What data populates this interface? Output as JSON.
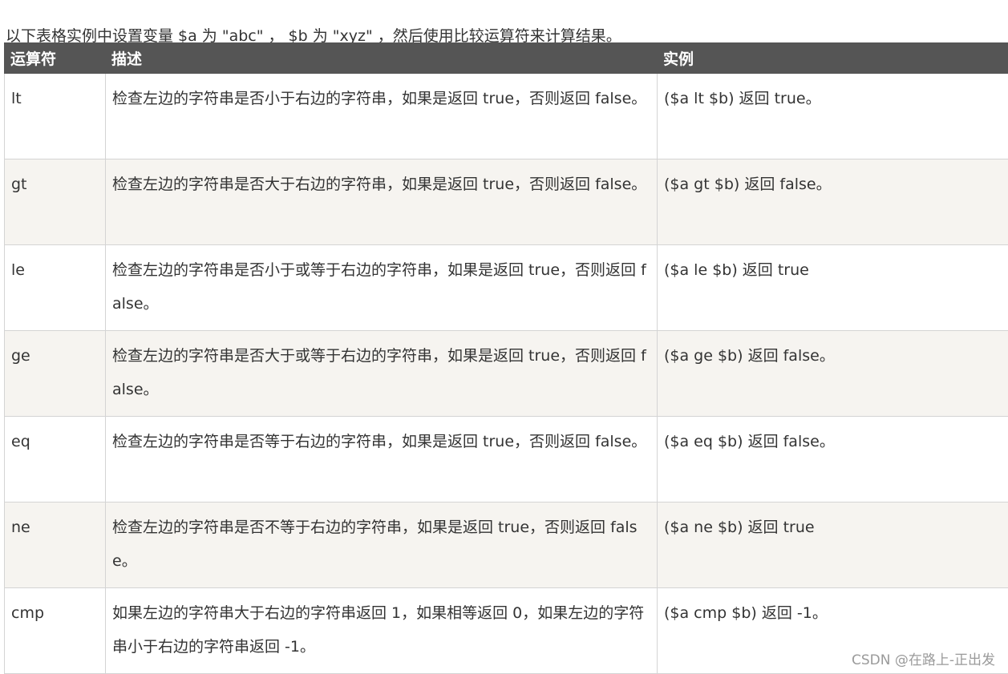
{
  "intro": "以下表格实例中设置变量 $a 为 \"abc\" ， $b 为 \"xyz\" ，然后使用比较运算符来计算结果。",
  "table": {
    "headers": [
      "运算符",
      "描述",
      "实例"
    ],
    "rows": [
      {
        "op": "lt",
        "desc": "检查左边的字符串是否小于右边的字符串，如果是返回 true，否则返回 false。",
        "example": "($a lt $b) 返回 true。"
      },
      {
        "op": "gt",
        "desc": "检查左边的字符串是否大于右边的字符串，如果是返回 true，否则返回 false。",
        "example": "($a gt $b) 返回 false。"
      },
      {
        "op": "le",
        "desc": "检查左边的字符串是否小于或等于右边的字符串，如果是返回 true，否则返回 false。",
        "example": "($a le $b) 返回 true"
      },
      {
        "op": "ge",
        "desc": "检查左边的字符串是否大于或等于右边的字符串，如果是返回 true，否则返回 false。",
        "example": "($a ge $b) 返回 false。"
      },
      {
        "op": "eq",
        "desc": "检查左边的字符串是否等于右边的字符串，如果是返回 true，否则返回 false。",
        "example": "($a eq $b) 返回 false。"
      },
      {
        "op": "ne",
        "desc": "检查左边的字符串是否不等于右边的字符串，如果是返回 true，否则返回 false。",
        "example": "($a ne $b) 返回 true"
      },
      {
        "op": "cmp",
        "desc": "如果左边的字符串大于右边的字符串返回 1，如果相等返回 0，如果左边的字符串小于右边的字符串返回 -1。",
        "example": "($a cmp $b) 返回 -1。"
      }
    ]
  },
  "watermark": "CSDN @在路上-正出发",
  "colors": {
    "header_bg": "#555555",
    "row_alt_bg": "#f6f4f0",
    "border": "#d4d4d4",
    "text": "#333333"
  }
}
